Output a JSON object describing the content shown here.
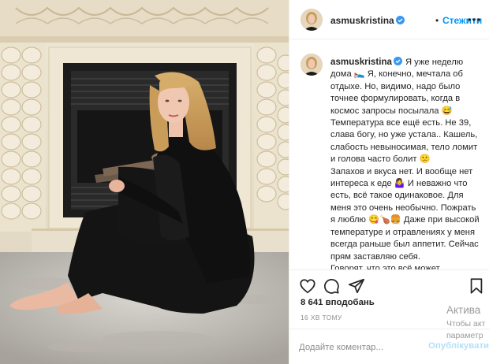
{
  "post": {
    "username": "asmuskristina",
    "follow_label": "Стежити",
    "dot": "•",
    "caption_lines": [
      "Я уже неделю дома 🛌 Я, конечно, мечтала об отдыхе. Но, видимо, надо было точнее формулировать, когда в космос запросы посылала 😅",
      "Температура все ещё есть. Не 39, слава богу, но уже устала.. Кашель, слабость невыносимая, тело ломит и голова часто болит 🙁",
      "Запахов и вкуса нет. И вообще нет интереса к еде 🤷‍♀️ И неважно что есть, всё такое одинаковое. Для меня это очень необычно. Пожрать я люблю 😋🍗🍔 Даже при высокой температуре и отравлениях у меня всегда раньше был аппетит. Сейчас прям заставляю себя.",
      "Говорят, что это всё может вернуться со временем... У кого-то"
    ],
    "likes": "8 641 вподобань",
    "time_ago": "16 хв тому",
    "comment_placeholder": "Додайте коментар...",
    "post_label": "Опублікувати"
  },
  "icons": {
    "verified": "verified-badge-icon",
    "more": "more-options-icon",
    "like": "heart-icon",
    "comment": "comment-icon",
    "share": "share-icon",
    "save": "bookmark-icon"
  },
  "watermark": {
    "line1": "Актива",
    "line2": "Чтобы акт",
    "line3": "параметр"
  },
  "colors": {
    "link_blue": "#0095f6",
    "post_disabled": "#b2dffc",
    "verified_blue": "#3897f0",
    "muted": "#8e8e8e"
  }
}
